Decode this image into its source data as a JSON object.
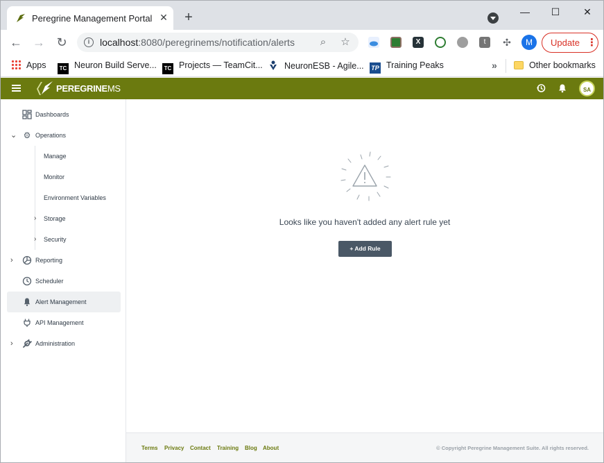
{
  "browser": {
    "tab_title": "Peregrine Management Portal",
    "tab_close": "✕",
    "new_tab": "+",
    "window_controls": {
      "minimize": "—",
      "maximize": "☐",
      "close": "✕"
    },
    "url_host": "localhost",
    "url_rest": ":8080/peregrinems/notification/alerts",
    "profile_initial": "M",
    "update_label": "Update",
    "update_menu": "⋮",
    "bookmarks": [
      {
        "label": "Apps",
        "icon": "apps-grid-icon"
      },
      {
        "label": "Neuron Build Serve...",
        "icon": "teamcity-icon",
        "badge": "TC"
      },
      {
        "label": "Projects — TeamCit...",
        "icon": "teamcity-icon",
        "badge": "TC"
      },
      {
        "label": "NeuronESB - Agile...",
        "icon": "jira-icon"
      },
      {
        "label": "Training Peaks",
        "icon": "trainingpeaks-icon",
        "badge": "TP"
      }
    ],
    "more_bookmarks": "»",
    "other_bookmarks": "Other bookmarks"
  },
  "app": {
    "logo_bold": "PEREGRINE",
    "logo_thin": "MS",
    "avatar_initials": "SA",
    "brand_color": "#6b7a0f"
  },
  "sidebar": {
    "items": [
      {
        "label": "Dashboards",
        "icon": "dashboard-grid-icon"
      },
      {
        "label": "Operations",
        "icon": "gear-icon",
        "expanded": true
      },
      {
        "label": "Reporting",
        "icon": "pie-chart-icon"
      },
      {
        "label": "Scheduler",
        "icon": "clock-icon"
      },
      {
        "label": "Alert Management",
        "icon": "bell-icon",
        "active": true
      },
      {
        "label": "API Management",
        "icon": "plug-icon"
      },
      {
        "label": "Administration",
        "icon": "wrench-icon"
      }
    ],
    "operations_children": [
      {
        "label": "Manage"
      },
      {
        "label": "Monitor"
      },
      {
        "label": "Environment Variables"
      },
      {
        "label": "Storage",
        "expandable": true
      },
      {
        "label": "Security",
        "expandable": true
      }
    ]
  },
  "main": {
    "empty_message": "Looks like you haven't added any alert rule yet",
    "add_rule_label": "+ Add Rule"
  },
  "footer": {
    "links": [
      "Terms",
      "Privacy",
      "Contact",
      "Training",
      "Blog",
      "About"
    ],
    "copyright": "© Copyright Peregrine Management Suite. All rights reserved."
  }
}
